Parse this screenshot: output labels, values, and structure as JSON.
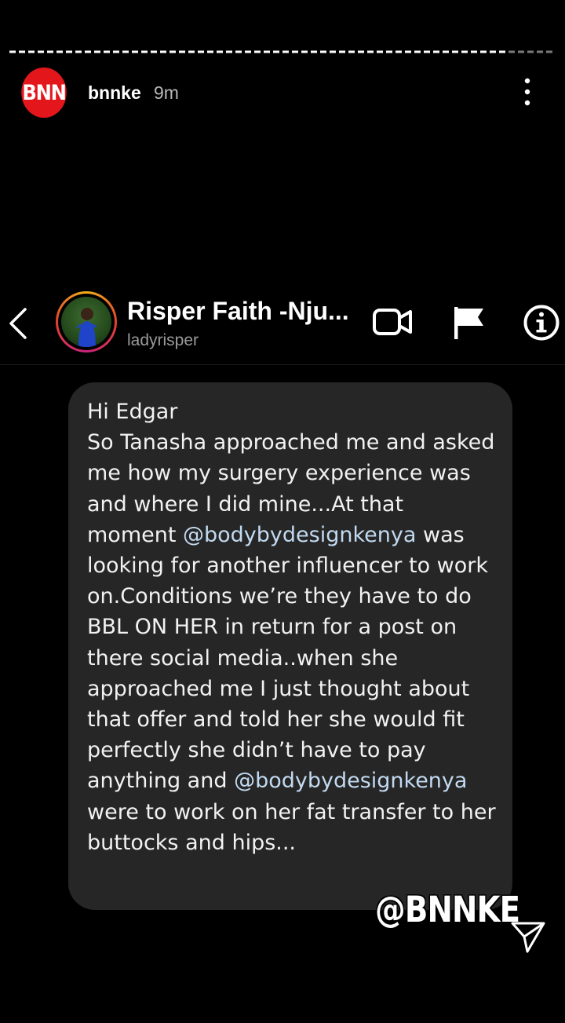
{
  "story": {
    "logo_text": "BNN",
    "username": "bnnke",
    "time": "9m",
    "more_icon": "more-vertical-icon",
    "progress": 0.9,
    "colors": {
      "logo": "#e3161c",
      "background": "#000000"
    }
  },
  "dm_header": {
    "name": "Risper Faith -Nju...",
    "handle": "ladyrisper",
    "icons": [
      "back-chevron-icon",
      "video-camera-icon",
      "flag-icon",
      "info-icon"
    ]
  },
  "message": {
    "greeting": "Hi Edgar",
    "part1": "So Tanasha approached me and asked me how my surgery experience was and where I did mine...At that moment ",
    "mention1": "@bodybydesignkenya",
    "part2": " was looking for another influencer to work on.Conditions we’re they have to do BBL ON HER in return for a post on there social media..when she approached me I just thought about that offer and told her she would fit perfectly she didn’t have to pay anything and ",
    "mention2": "@bodybydesignkenya",
    "part3": " were to work on her fat transfer to her buttocks and hips...",
    "colors": {
      "bubble": "#262626",
      "mention": "#c2daf1"
    }
  },
  "watermark": "@BNNKE",
  "send_icon": "send-paper-plane-icon"
}
